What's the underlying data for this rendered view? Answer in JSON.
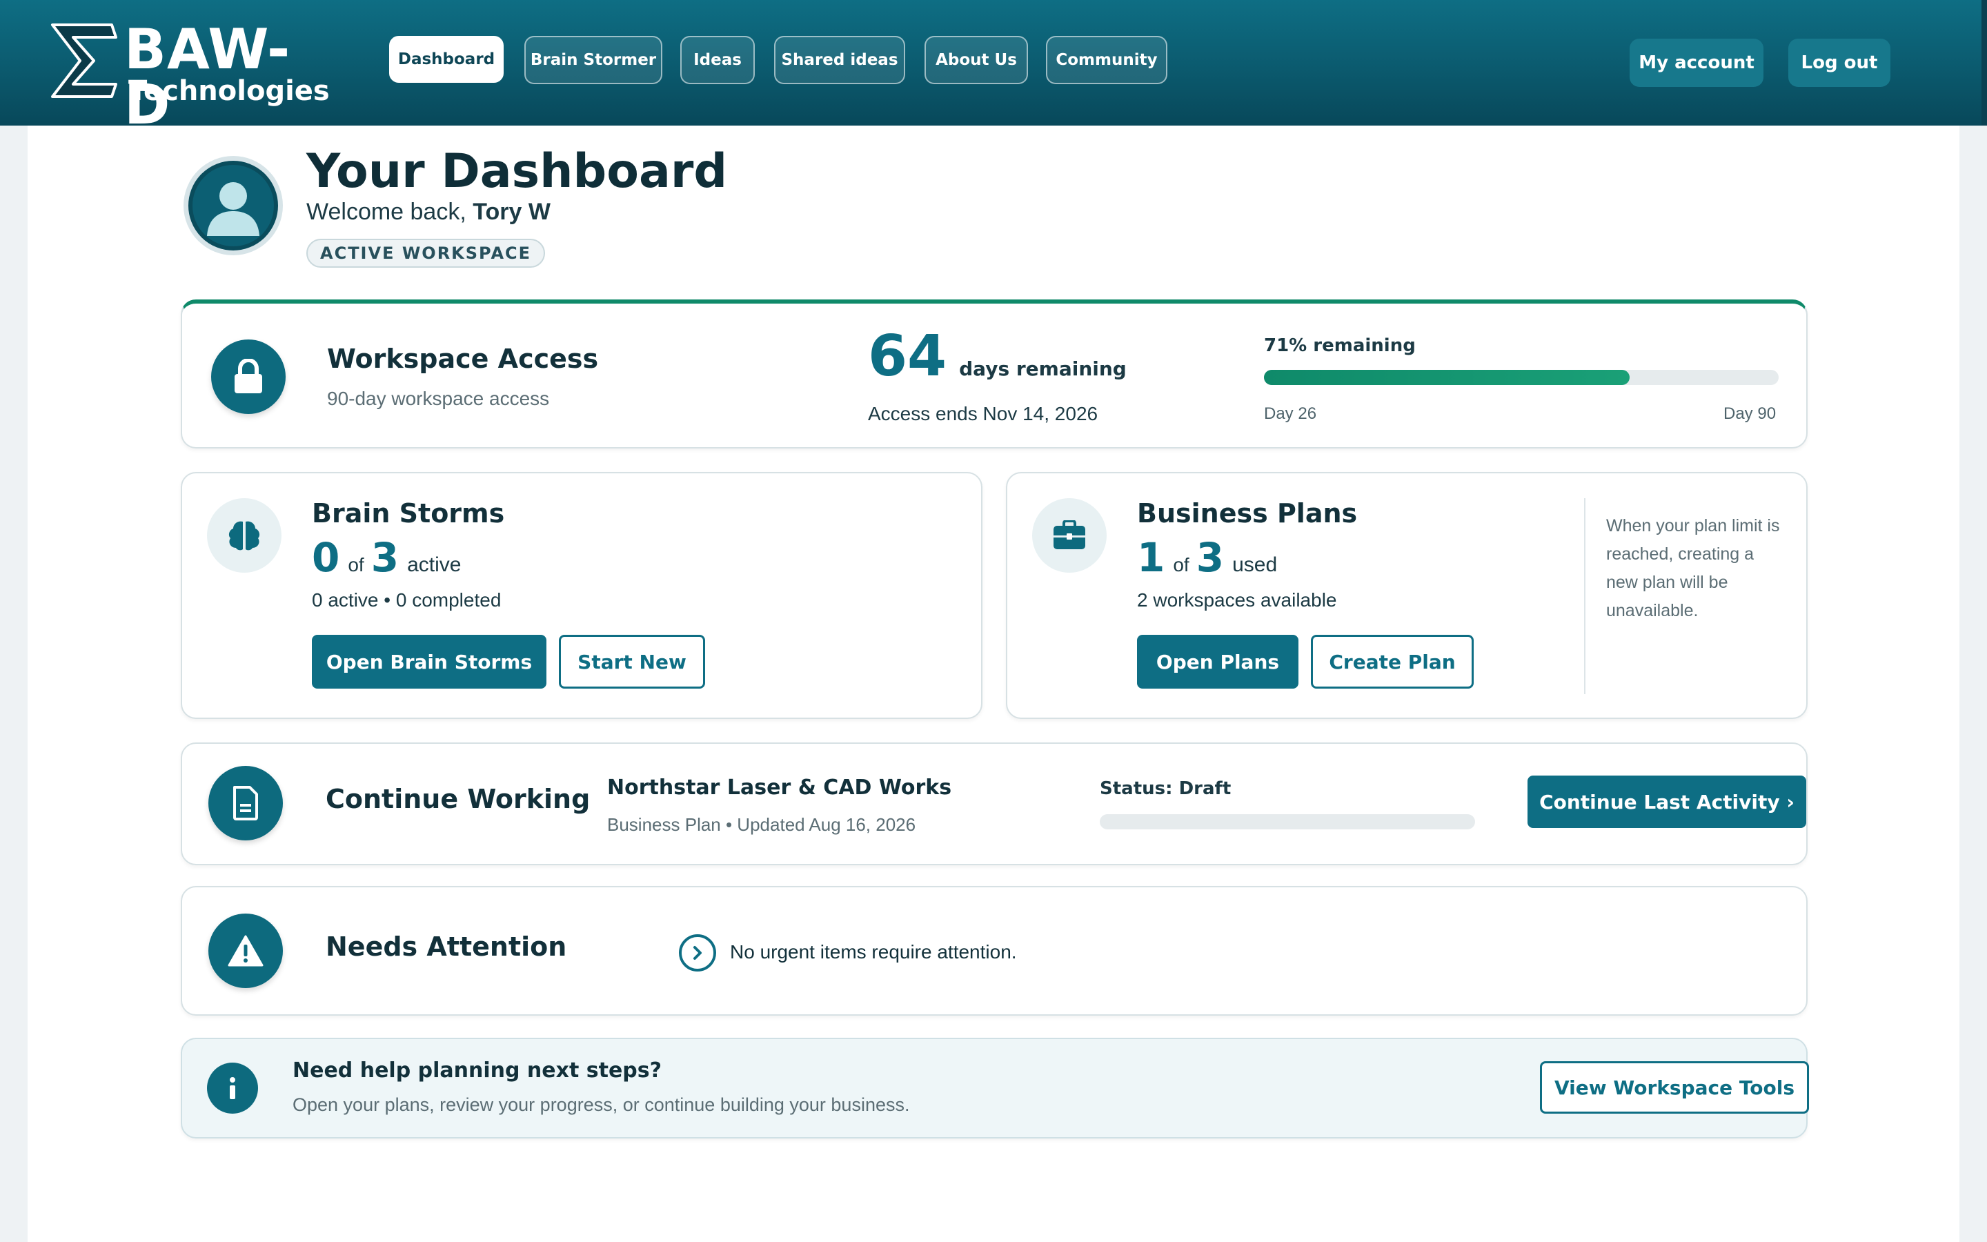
{
  "brand": {
    "name": "BAW-D",
    "subtitle": "Technologies"
  },
  "nav": {
    "items": [
      {
        "label": "Dashboard",
        "active": true
      },
      {
        "label": "Brain Stormer"
      },
      {
        "label": "Ideas"
      },
      {
        "label": "Shared ideas"
      },
      {
        "label": "About Us"
      },
      {
        "label": "Community"
      }
    ],
    "my_account": "My account",
    "logout": "Log out"
  },
  "profile": {
    "title": "Your Dashboard",
    "welcome_prefix": "Welcome back, ",
    "user_name": "Tory W",
    "badge": "ACTIVE WORKSPACE",
    "avatar_icon": "user-icon"
  },
  "access": {
    "title": "Workspace Access",
    "subtitle": "90-day workspace access",
    "days_remaining": "64",
    "days_label": "days remaining",
    "ends": "Access ends Nov 14, 2026",
    "remaining_label": "71% remaining",
    "progress_fraction": 0.71,
    "day_start": "Day 26",
    "day_end": "Day 90",
    "icon": "lock-icon",
    "accent": "#0f8a6a"
  },
  "brainstorms": {
    "title": "Brain Storms",
    "count": "0",
    "of": "of",
    "total": "3",
    "unit": "active",
    "detail": "0 active • 0 completed",
    "primary_btn": "Open Brain Storms",
    "secondary_btn": "Start New",
    "icon": "brain-icon"
  },
  "plans": {
    "title": "Business Plans",
    "count": "1",
    "of": "of",
    "total": "3",
    "unit": "used",
    "detail": "2 workspaces available",
    "primary_btn": "Open Plans",
    "secondary_btn": "Create Plan",
    "note": "When your plan limit is reached, creating a new plan will be unavailable.",
    "icon": "briefcase-icon"
  },
  "continue": {
    "title": "Continue Working",
    "project": "Northstar Laser & CAD Works",
    "meta": "Business Plan • Updated Aug 16, 2026",
    "status": "Status: Draft",
    "status_fraction": 0,
    "button": "Continue Last Activity ›",
    "icon": "document-icon"
  },
  "attention": {
    "title": "Needs Attention",
    "message": "No urgent items require attention.",
    "icon": "warning-icon",
    "item_icon": "chevron-right-circle-icon"
  },
  "help": {
    "title": "Need help planning next steps?",
    "text": "Open your plans, review your progress, or continue building your business.",
    "button": "View Workspace Tools",
    "icon": "info-icon"
  },
  "colors": {
    "brand": "#0e6e84",
    "header_top": "#0e6e84",
    "header_bottom": "#08485a",
    "progress_green": "#1aa077"
  }
}
